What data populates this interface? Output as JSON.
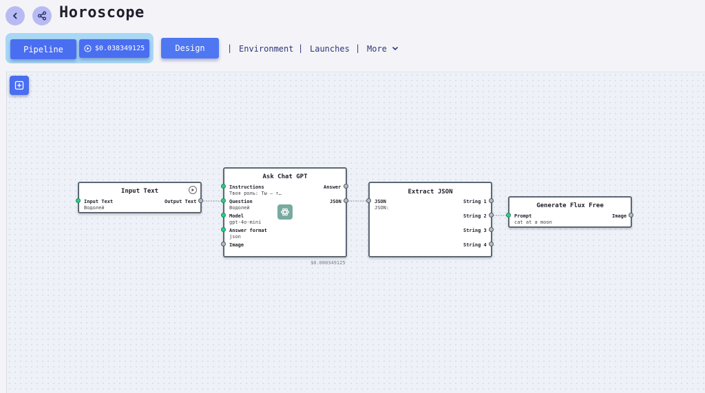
{
  "header": {
    "title": "Horoscope",
    "pipeline_label": "Pipeline",
    "cost": "$0.038349125",
    "design_label": "Design",
    "nav": [
      "Environment",
      "Launches",
      "More"
    ],
    "separator": "|"
  },
  "nodes": {
    "input_text": {
      "title": "Input Text",
      "in_label": "Input Text",
      "in_value": "Водолей",
      "out_label": "Output Text"
    },
    "ask_chat_gpt": {
      "title": "Ask Chat GPT",
      "inputs": [
        {
          "label": "Instructions",
          "value": "Твоя роль: Ты — т…"
        },
        {
          "label": "Question",
          "value": "Водолей"
        },
        {
          "label": "Model",
          "value": "gpt-4o-mini"
        },
        {
          "label": "Answer format",
          "value": "json"
        },
        {
          "label": "Image",
          "value": ""
        }
      ],
      "outputs": [
        "Answer",
        "JSON"
      ],
      "cost": "$0.000349125"
    },
    "extract_json": {
      "title": "Extract JSON",
      "in_label": "JSON",
      "in_value": "JSON:",
      "outputs": [
        "String 1",
        "String 2",
        "String 3",
        "String 4"
      ]
    },
    "generate_flux": {
      "title": "Generate Flux Free",
      "in_label": "Prompt",
      "in_value": "cat at a moon",
      "out_label": "Image"
    }
  },
  "icons": {
    "back": "chevron-left-icon",
    "share": "share-icon",
    "run": "play-circle-icon",
    "add": "plus-square-icon",
    "more": "chevron-down-icon",
    "gpt": "openai-icon"
  },
  "colors": {
    "accent": "#4a6ef0",
    "port_connected": "#2fcf85",
    "port_empty": "#b7bcc2"
  }
}
